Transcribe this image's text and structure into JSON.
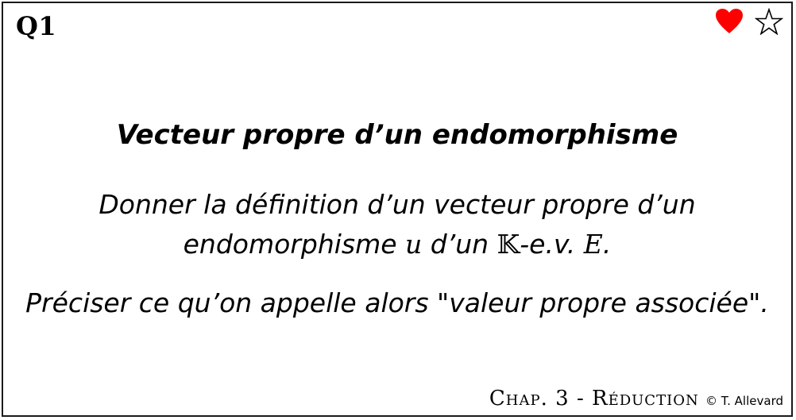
{
  "card": {
    "id": "Q1",
    "title": "Vecteur propre d’un endomorphisme",
    "line1": "Donner la définition d’un vecteur propre d’un",
    "line2_pre": "endomorphisme ",
    "line2_var_u": "u",
    "line2_mid": " d’un ",
    "line2_field": "𝕂",
    "line2_post": "-e.v. ",
    "line2_var_E": "E",
    "line2_end": ".",
    "line3": "Préciser ce qu’on appelle alors \"valeur propre associée\".",
    "footer_chapter": "Chap. 3 - Réduction",
    "footer_author": "© T. Allevard"
  },
  "icons": {
    "favorite": "heart-icon",
    "star": "star-outline-icon",
    "heart_color": "#ff0000"
  }
}
